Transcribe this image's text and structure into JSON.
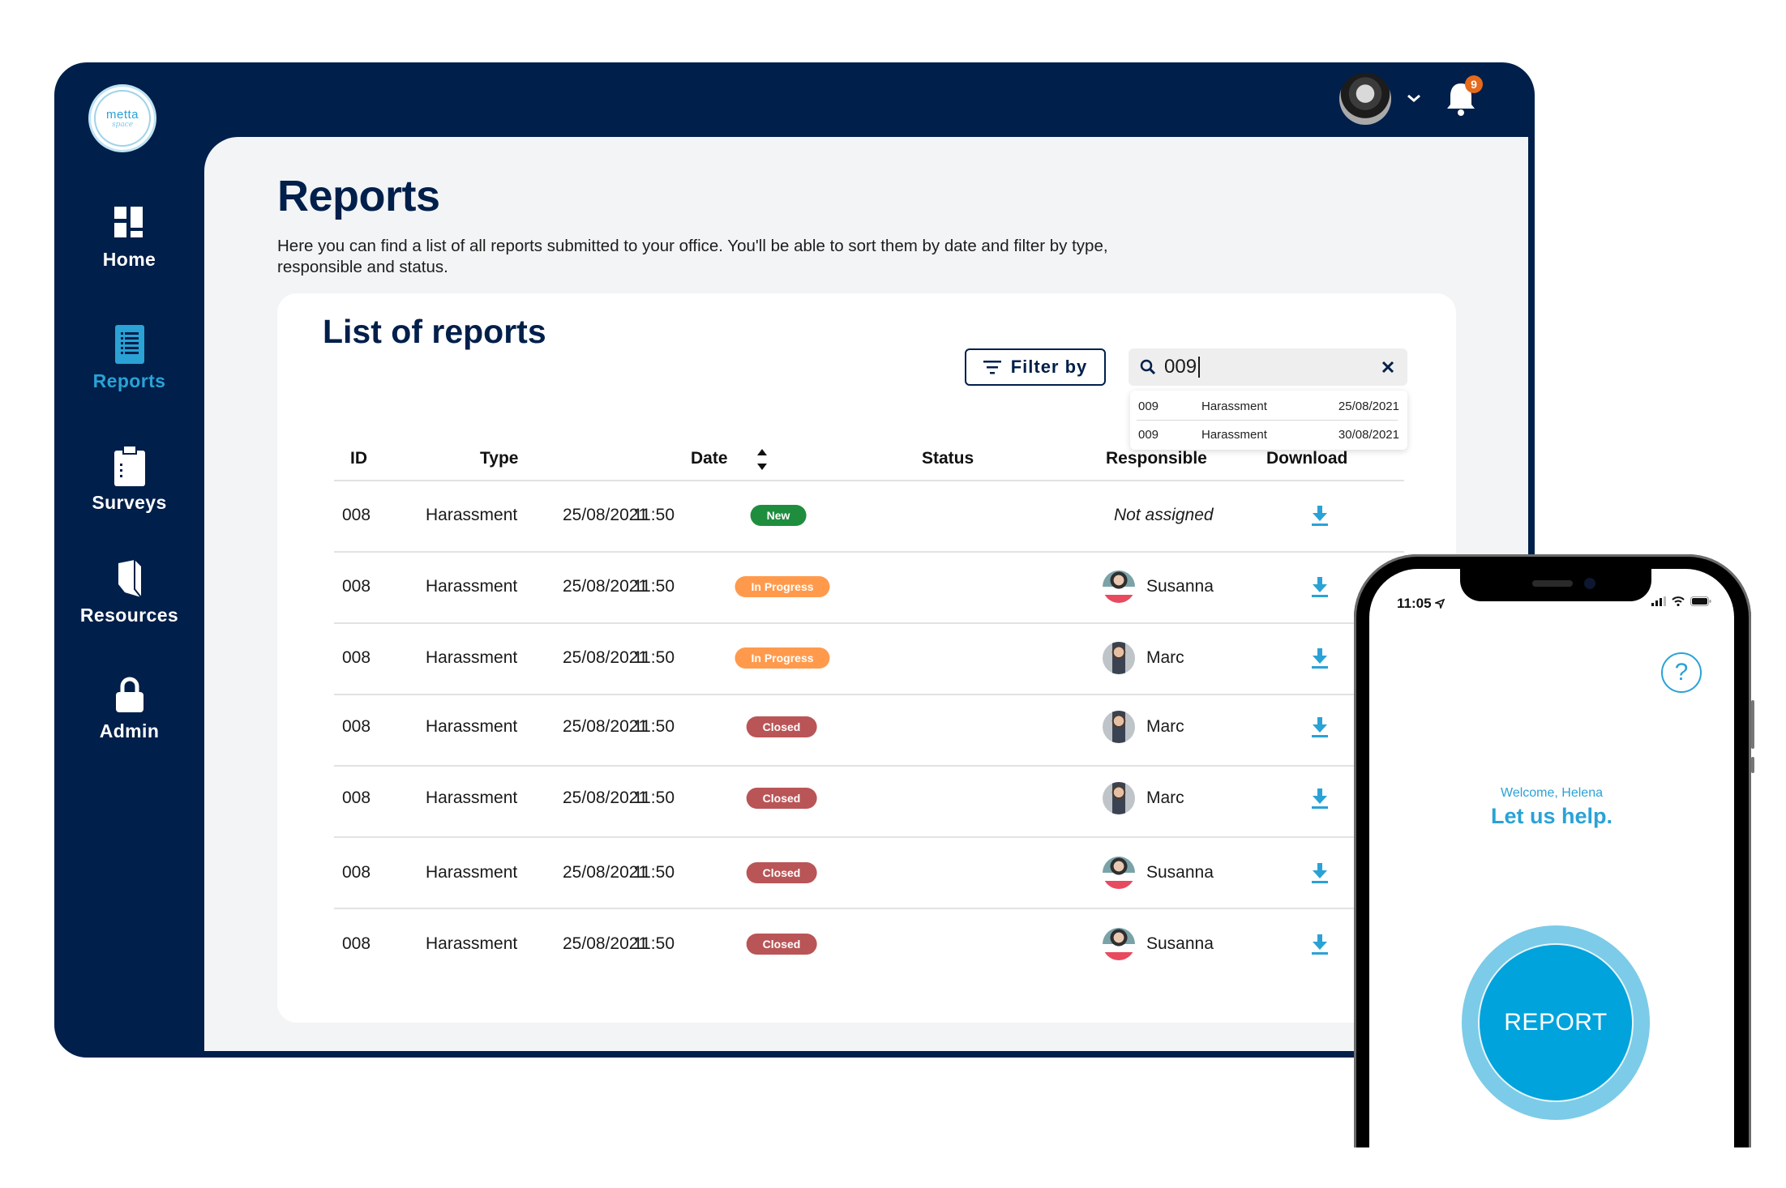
{
  "app": {
    "logo": {
      "line1": "metta",
      "line2": "space"
    },
    "sidebar": {
      "items": [
        {
          "label": "Home",
          "icon": "home-grid-icon",
          "active": false
        },
        {
          "label": "Reports",
          "icon": "reports-list-icon",
          "active": true
        },
        {
          "label": "Surveys",
          "icon": "clipboard-icon",
          "active": false
        },
        {
          "label": "Resources",
          "icon": "book-icon",
          "active": false
        },
        {
          "label": "Admin",
          "icon": "lock-icon",
          "active": false
        }
      ]
    },
    "topbar": {
      "avatar": "user-avatar",
      "notifications_count": "9"
    },
    "page": {
      "title": "Reports",
      "description": "Here you can find a list of all reports submitted to your office. You'll be able to sort them by date and filter by type, responsible and status."
    },
    "card": {
      "title": "List of reports",
      "filter_label": "Filter by",
      "search": {
        "value": "009",
        "suggestions": [
          {
            "id": "009",
            "type": "Harassment",
            "date": "25/08/2021"
          },
          {
            "id": "009",
            "type": "Harassment",
            "date": "30/08/2021"
          }
        ]
      },
      "columns": [
        "ID",
        "Type",
        "Date",
        "Status",
        "Responsible",
        "Download"
      ],
      "rows": [
        {
          "id": "008",
          "type": "Harassment",
          "date": "25/08/2021",
          "time": "11:50",
          "status": "New",
          "responsible": "Not assigned"
        },
        {
          "id": "008",
          "type": "Harassment",
          "date": "25/08/2021",
          "time": "11:50",
          "status": "In Progress",
          "responsible": "Susanna"
        },
        {
          "id": "008",
          "type": "Harassment",
          "date": "25/08/2021",
          "time": "11:50",
          "status": "In Progress",
          "responsible": "Marc"
        },
        {
          "id": "008",
          "type": "Harassment",
          "date": "25/08/2021",
          "time": "11:50",
          "status": "Closed",
          "responsible": "Marc"
        },
        {
          "id": "008",
          "type": "Harassment",
          "date": "25/08/2021",
          "time": "11:50",
          "status": "Closed",
          "responsible": "Marc"
        },
        {
          "id": "008",
          "type": "Harassment",
          "date": "25/08/2021",
          "time": "11:50",
          "status": "Closed",
          "responsible": "Susanna"
        },
        {
          "id": "008",
          "type": "Harassment",
          "date": "25/08/2021",
          "time": "11:50",
          "status": "Closed",
          "responsible": "Susanna"
        }
      ]
    },
    "status_colors": {
      "New": "#1e8e3e",
      "In Progress": "#ff9a4d",
      "Closed": "#b95557"
    },
    "colors": {
      "navy": "#001f4a",
      "accent": "#2aa2d6"
    }
  },
  "phone": {
    "status_time": "11:05",
    "help_label": "?",
    "welcome": "Welcome, Helena",
    "headline": "Let us help.",
    "report_button": "REPORT"
  }
}
